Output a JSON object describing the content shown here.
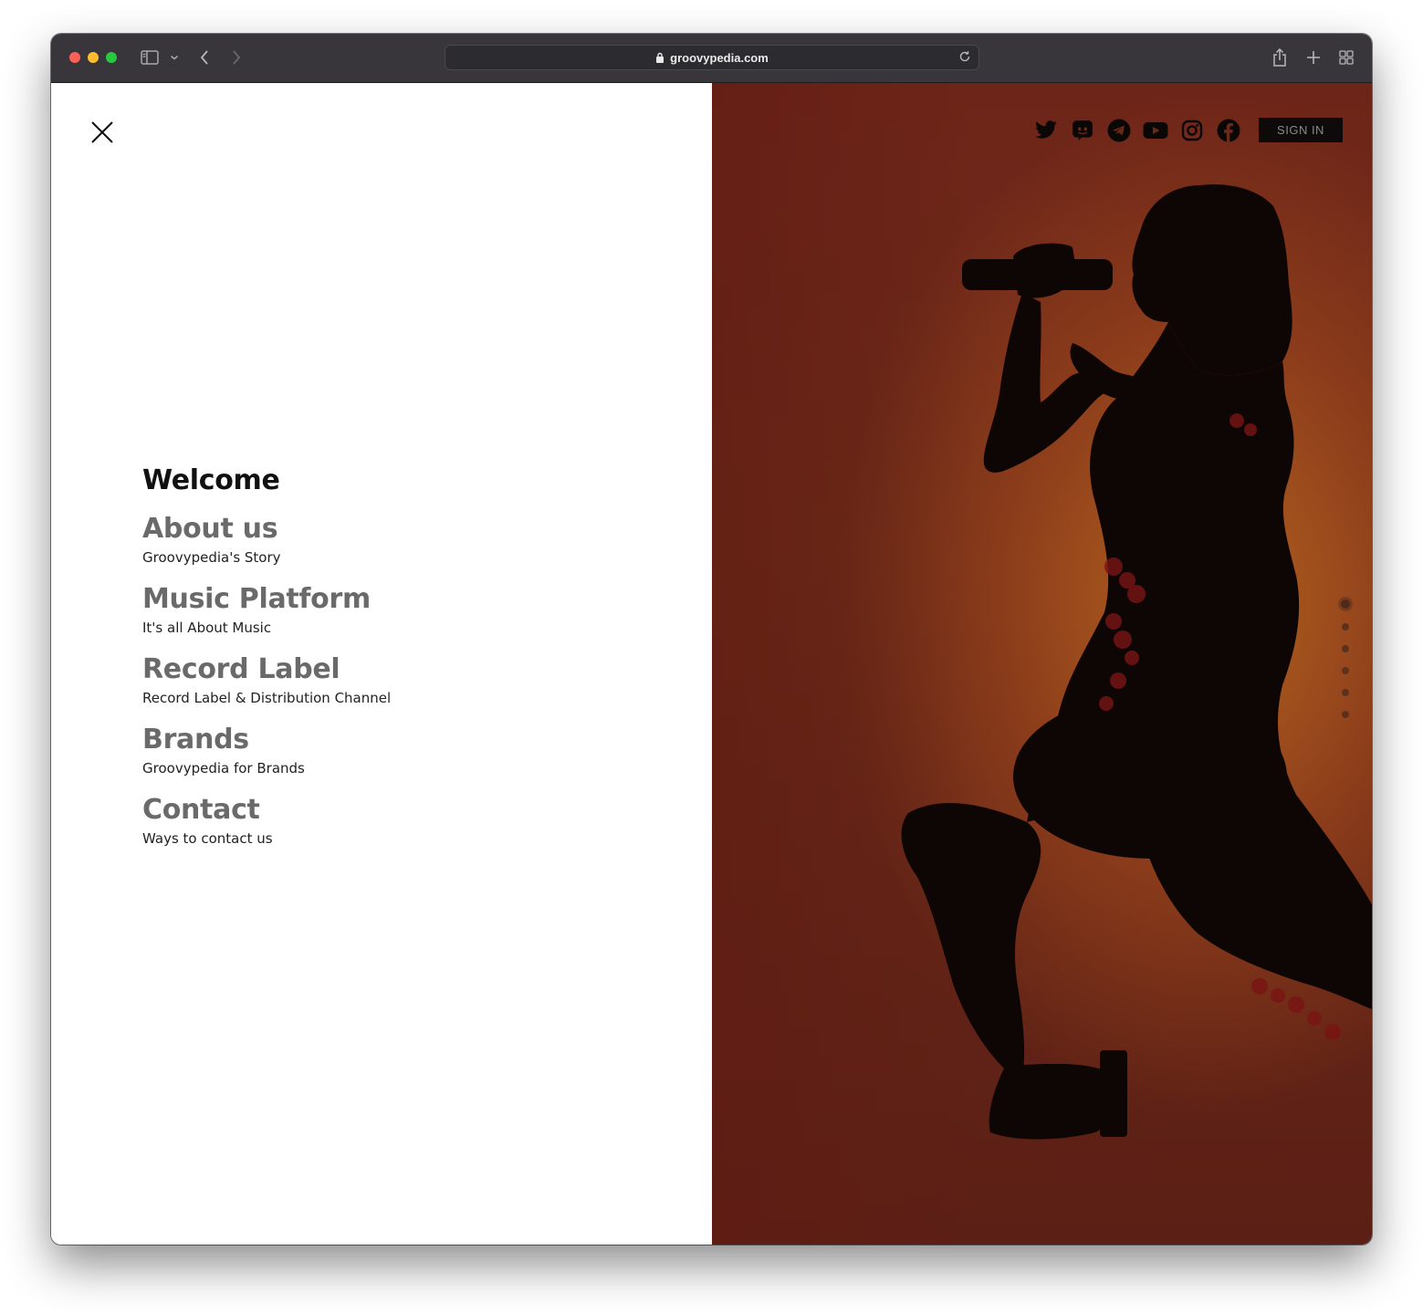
{
  "browser": {
    "url": "groovypedia.com"
  },
  "menu": {
    "welcome": "Welcome",
    "items": [
      {
        "title": "About us",
        "subtitle": "Groovypedia's Story"
      },
      {
        "title": "Music Platform",
        "subtitle": "It's all About Music"
      },
      {
        "title": "Record Label",
        "subtitle": "Record Label & Distribution Channel"
      },
      {
        "title": "Brands",
        "subtitle": "Groovypedia for Brands"
      },
      {
        "title": "Contact",
        "subtitle": "Ways to contact us"
      }
    ]
  },
  "header": {
    "sign_in_label": "SIGN IN",
    "social_icons": [
      "twitter-icon",
      "discord-icon",
      "telegram-icon",
      "youtube-icon",
      "instagram-icon",
      "facebook-icon"
    ]
  },
  "slider": {
    "total_slides": 6,
    "active_slide": 1
  },
  "colors": {
    "hero_accent": "#c46e20",
    "hero_base": "#6a2a18",
    "chrome": "#38363b"
  }
}
